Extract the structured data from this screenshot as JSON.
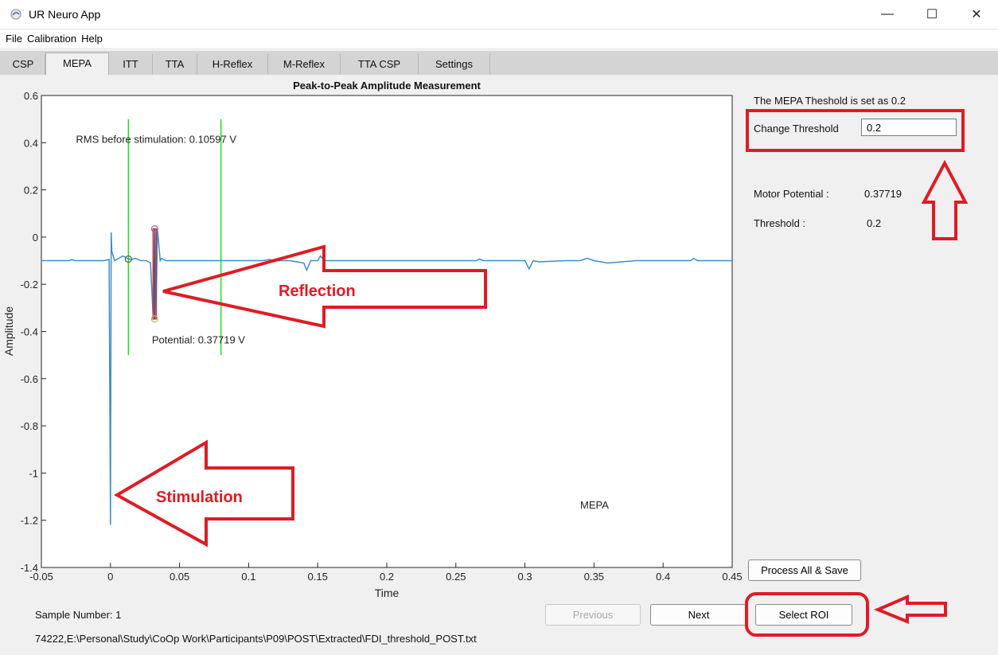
{
  "window": {
    "title": "UR Neuro App",
    "minimize": "—",
    "maximize": "☐",
    "close": "✕"
  },
  "menu": [
    "File",
    "Calibration",
    "Help"
  ],
  "tabs": [
    "CSP",
    "MEPA",
    "ITT",
    "TTA",
    "H-Reflex",
    "M-Reflex",
    "TTA CSP",
    "Settings"
  ],
  "active_tab": "MEPA",
  "side_panel": {
    "threshold_info": "The MEPA Theshold is set as  0.2",
    "change_threshold_label": "Change Threshold",
    "change_threshold_value": "0.2",
    "motor_potential_label": "Motor Potential :",
    "motor_potential_value": "0.37719",
    "threshold_label": "Threshold :",
    "threshold_value": "0.2"
  },
  "buttons": {
    "process_all_save": "Process All & Save",
    "previous": "Previous",
    "next": "Next",
    "select_roi": "Select ROI"
  },
  "status": {
    "sample_number": "Sample Number: 1",
    "file_path": "74222,E:\\Personal\\Study\\CoOp Work\\Participants\\P09\\POST\\Extracted\\FDI_threshold_POST.txt"
  },
  "annotations": {
    "reflection": "Reflection",
    "stimulation": "Stimulation",
    "highlight_color": "#e01b24"
  },
  "chart_data": {
    "type": "line",
    "title": "Peak-to-Peak Amplitude Measurement",
    "xlabel": "Time",
    "ylabel": "Amplitude",
    "xlim": [
      -0.05,
      0.45
    ],
    "ylim": [
      -1.4,
      0.6
    ],
    "xticks": [
      "-0.05",
      "0",
      "0.05",
      "0.1",
      "0.15",
      "0.2",
      "0.25",
      "0.3",
      "0.35",
      "0.4",
      "0.45"
    ],
    "yticks": [
      "0.6",
      "0.4",
      "0.2",
      "0",
      "-0.2",
      "-0.4",
      "-0.6",
      "-0.8",
      "-1",
      "-1.2",
      "-1.4"
    ],
    "line_color": "#3a8fd0",
    "roi_lines": [
      0.013,
      0.08
    ],
    "roi_color": "#22dd22",
    "baseline": -0.1,
    "signal": [
      [
        -0.05,
        -0.1
      ],
      [
        -0.03,
        -0.1
      ],
      [
        -0.028,
        -0.095
      ],
      [
        -0.026,
        -0.1
      ],
      [
        -0.005,
        -0.1
      ],
      [
        -0.001,
        -0.095
      ],
      [
        0.0,
        -1.22
      ],
      [
        0.0005,
        0.02
      ],
      [
        0.001,
        -0.06
      ],
      [
        0.003,
        -0.1
      ],
      [
        0.006,
        -0.09
      ],
      [
        0.009,
        -0.08
      ],
      [
        0.012,
        -0.09
      ],
      [
        0.015,
        -0.095
      ],
      [
        0.018,
        -0.09
      ],
      [
        0.022,
        -0.1
      ],
      [
        0.026,
        -0.1
      ],
      [
        0.029,
        -0.11
      ],
      [
        0.031,
        -0.35
      ],
      [
        0.032,
        0.03
      ],
      [
        0.033,
        -0.34
      ],
      [
        0.034,
        0.035
      ],
      [
        0.036,
        -0.1
      ],
      [
        0.037,
        -0.09
      ],
      [
        0.04,
        -0.1
      ],
      [
        0.08,
        -0.1
      ],
      [
        0.11,
        -0.1
      ],
      [
        0.115,
        -0.095
      ],
      [
        0.12,
        -0.1
      ],
      [
        0.13,
        -0.1
      ],
      [
        0.14,
        -0.11
      ],
      [
        0.142,
        -0.14
      ],
      [
        0.145,
        -0.1
      ],
      [
        0.15,
        -0.1
      ],
      [
        0.152,
        -0.08
      ],
      [
        0.155,
        -0.1
      ],
      [
        0.2,
        -0.1
      ],
      [
        0.265,
        -0.1
      ],
      [
        0.267,
        -0.093
      ],
      [
        0.27,
        -0.1
      ],
      [
        0.3,
        -0.1
      ],
      [
        0.303,
        -0.135
      ],
      [
        0.306,
        -0.1
      ],
      [
        0.31,
        -0.105
      ],
      [
        0.33,
        -0.1
      ],
      [
        0.34,
        -0.1
      ],
      [
        0.345,
        -0.09
      ],
      [
        0.35,
        -0.1
      ],
      [
        0.36,
        -0.11
      ],
      [
        0.38,
        -0.1
      ],
      [
        0.42,
        -0.1
      ],
      [
        0.422,
        -0.09
      ],
      [
        0.425,
        -0.1
      ],
      [
        0.45,
        -0.1
      ]
    ],
    "peak_to_peak": {
      "x": 0.032,
      "min": -0.347,
      "max": 0.035
    },
    "onset_marker": {
      "x": 0.013,
      "y": -0.093
    },
    "labels": [
      {
        "text": "RMS before stimulation: 0.10597 V",
        "x": -0.025,
        "y": 0.4
      },
      {
        "text": "Potential: 0.37719 V",
        "x": 0.03,
        "y": -0.45
      },
      {
        "text": "MEPA",
        "x": 0.34,
        "y": -1.15
      }
    ]
  }
}
